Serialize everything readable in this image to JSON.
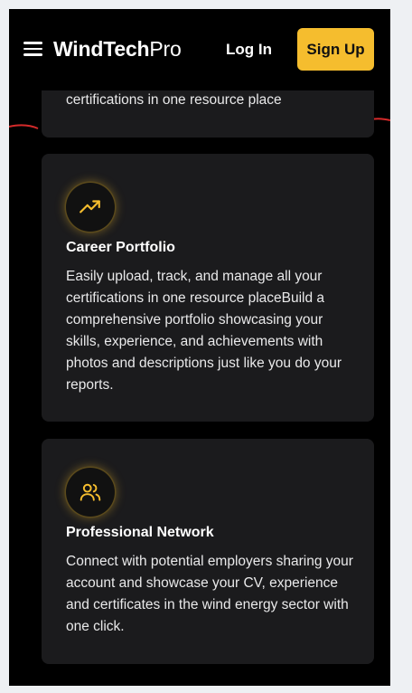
{
  "header": {
    "logo_bold": "WindTech",
    "logo_light": "Pro",
    "login_label": "Log In",
    "signup_label": "Sign Up"
  },
  "colors": {
    "accent": "#f5bd2e",
    "card_bg": "#1b1b1d",
    "page_bg": "#000000"
  },
  "cards": [
    {
      "title": "",
      "text": "certifications in one resource place"
    },
    {
      "icon": "trending-up-icon",
      "title": "Career Portfolio",
      "text": "Easily upload, track, and manage all your certifications in one resource placeBuild a comprehensive portfolio showcasing your skills, experience, and achievements with photos and descriptions just like you do your reports."
    },
    {
      "icon": "users-icon",
      "title": "Professional Network",
      "text": "Connect with potential employers sharing your account and showcase your CV, experience and certificates in the wind energy sector with one click."
    }
  ]
}
